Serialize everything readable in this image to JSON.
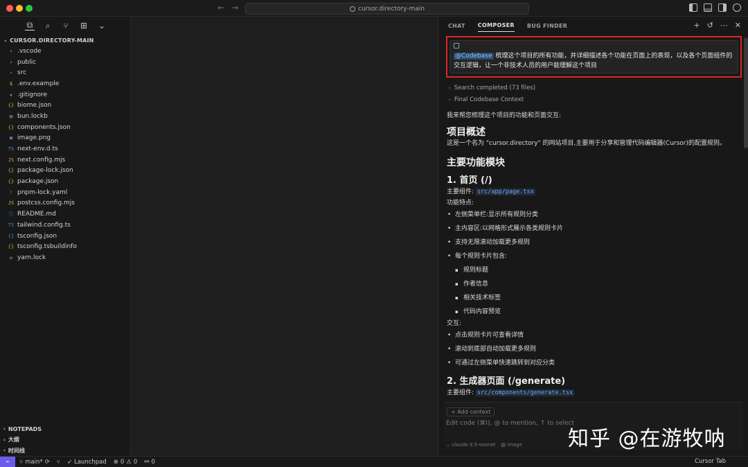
{
  "titlebar": {
    "search_text": "cursor.directory-main",
    "back_icon": "←",
    "forward_icon": "→"
  },
  "sidebar": {
    "explorer_title": "CURSOR.DIRECTORY-MAIN",
    "files": [
      {
        "name": ".vscode",
        "icon": "›",
        "color": "#c5c5c5"
      },
      {
        "name": "public",
        "icon": "›",
        "color": "#c5c5c5"
      },
      {
        "name": "src",
        "icon": "›",
        "color": "#c5c5c5"
      },
      {
        "name": ".env.example",
        "icon": "$",
        "color": "#e0c341"
      },
      {
        "name": ".gitignore",
        "icon": "◆",
        "color": "#6e6e6e"
      },
      {
        "name": "biome.json",
        "icon": "{}",
        "color": "#d7ba3d"
      },
      {
        "name": "bun.lockb",
        "icon": "▤",
        "color": "#9d9d9d"
      },
      {
        "name": "components.json",
        "icon": "{}",
        "color": "#d7ba3d"
      },
      {
        "name": "image.png",
        "icon": "▣",
        "color": "#a074c4"
      },
      {
        "name": "next-env.d.ts",
        "icon": "TS",
        "color": "#4a90d9"
      },
      {
        "name": "next.config.mjs",
        "icon": "JS",
        "color": "#d7ba3d"
      },
      {
        "name": "package-lock.json",
        "icon": "{}",
        "color": "#d7ba3d"
      },
      {
        "name": "package.json",
        "icon": "{}",
        "color": "#d7ba3d"
      },
      {
        "name": "pnpm-lock.yaml",
        "icon": "!",
        "color": "#a074c4"
      },
      {
        "name": "postcss.config.mjs",
        "icon": "JS",
        "color": "#d7ba3d"
      },
      {
        "name": "README.md",
        "icon": "ⓘ",
        "color": "#4a90d9"
      },
      {
        "name": "tailwind.config.ts",
        "icon": "TS",
        "color": "#4a90d9"
      },
      {
        "name": "tsconfig.json",
        "icon": "{}",
        "color": "#4a90d9"
      },
      {
        "name": "tsconfig.tsbuildinfo",
        "icon": "{}",
        "color": "#d7ba3d"
      },
      {
        "name": "yarn.lock",
        "icon": "✿",
        "color": "#4a90d9"
      }
    ],
    "bottom_sections": [
      "NOTEPADS",
      "大纲",
      "时间线"
    ]
  },
  "panel": {
    "tabs": [
      "CHAT",
      "COMPOSER",
      "BUG FINDER"
    ],
    "prompt": {
      "mention": "@Codebase",
      "text": " 梳理这个项目的所有功能，并详细描述各个功能在页面上的表现，以及各个页面组件的交互逻辑，让一个非技术人员的用户能理解这个项目"
    },
    "search_completed": "Search completed (73 files)",
    "final_context": "Final Codebase Context",
    "response": {
      "intro": "我来帮您梳理这个项目的功能和页面交互:",
      "h_overview": "项目概述",
      "overview_text": "这是一个名为 \"cursor.directory\" 的网站项目,主要用于分享和管理代码编辑器(Cursor)的配置规则。",
      "h_modules": "主要功能模块",
      "h_home": "1. 首页 (/)",
      "main_component_label": "主要组件: ",
      "home_component": "src/app/page.tsx",
      "features_label": "功能特点:",
      "features": [
        "左侧菜单栏:显示所有规则分类",
        "主内容区:以网格形式展示各类规则卡片",
        "支持无限滚动加载更多规则",
        "每个规则卡片包含:"
      ],
      "card_items": [
        "规则标题",
        "作者信息",
        "相关技术标签",
        "代码内容预览"
      ],
      "interaction_label": "交互:",
      "interactions": [
        "点击规则卡片可查看详情",
        "滚动到底部自动加载更多规则",
        "可通过左侧菜单快速跳转到对应分类"
      ],
      "h_generate": "2. 生成器页面 (/generate)",
      "generate_component": "src/components/generate.tsx"
    },
    "input": {
      "add_context": "+ Add context",
      "placeholder": "Edit code (⌘I), @ to mention, ↑ to select",
      "model": "⌄ claude-3.5-sonnet",
      "image": "▨ image"
    }
  },
  "watermark": "知乎 @在游牧呐",
  "statusbar": {
    "branch": "main*",
    "launchpad": "Launchpad",
    "errors": "0",
    "warnings": "0",
    "ports": "0",
    "right": "Cursor Tab"
  }
}
